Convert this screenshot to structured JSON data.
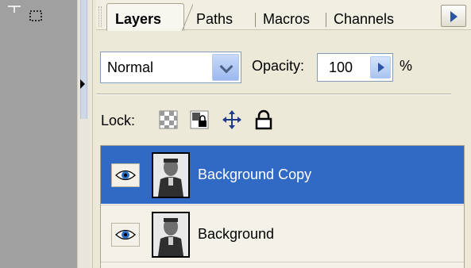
{
  "tabs": [
    {
      "label": "Layers",
      "active": true
    },
    {
      "label": "Paths",
      "active": false
    },
    {
      "label": "Macros",
      "active": false
    },
    {
      "label": "Channels",
      "active": false
    }
  ],
  "blend_mode": {
    "value": "Normal"
  },
  "opacity": {
    "label": "Opacity:",
    "value": "100",
    "unit": "%"
  },
  "lock": {
    "label": "Lock:",
    "icons": [
      "lock-transparency-icon",
      "lock-image-icon",
      "lock-position-icon",
      "lock-all-icon"
    ]
  },
  "layers": [
    {
      "name": "Background Copy",
      "selected": true,
      "visible": true
    },
    {
      "name": "Background",
      "selected": false,
      "visible": true
    }
  ],
  "colors": {
    "selection": "#316ac5",
    "panel": "#ece9d8",
    "toolbox": "#a0a0a0"
  }
}
